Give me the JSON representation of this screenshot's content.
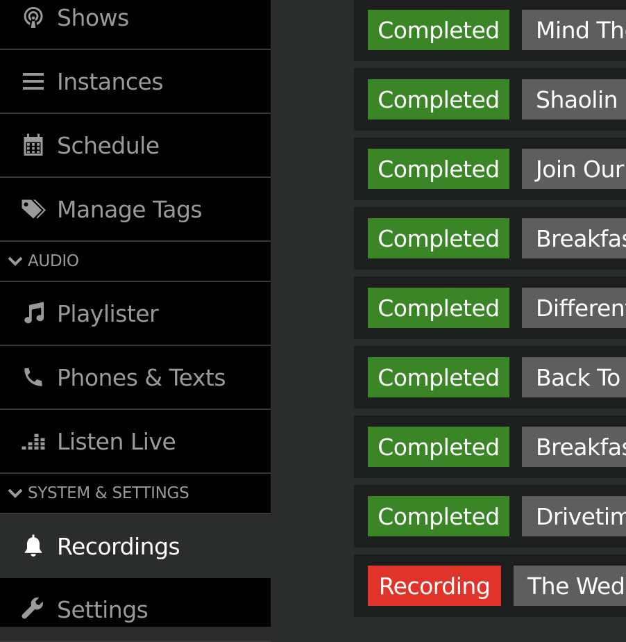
{
  "sidebar": {
    "items": [
      {
        "label": "Shows",
        "icon": "podcast-icon"
      },
      {
        "label": "Instances",
        "icon": "list-icon"
      },
      {
        "label": "Schedule",
        "icon": "calendar-icon"
      },
      {
        "label": "Manage Tags",
        "icon": "tags-icon"
      },
      {
        "label": "Playlister",
        "icon": "music-note-icon"
      },
      {
        "label": "Phones & Texts",
        "icon": "phone-icon"
      },
      {
        "label": "Listen Live",
        "icon": "equalizer-icon"
      },
      {
        "label": "Recordings",
        "icon": "bell-icon",
        "active": true
      },
      {
        "label": "Settings",
        "icon": "wrench-icon"
      }
    ],
    "sections": [
      {
        "label": "AUDIO"
      },
      {
        "label": "SYSTEM & SETTINGS"
      }
    ]
  },
  "recordings": [
    {
      "status": "Completed",
      "title": "Mind The Gap"
    },
    {
      "status": "Completed",
      "title": "Shaolin D"
    },
    {
      "status": "Completed",
      "title": "Join Our C"
    },
    {
      "status": "Completed",
      "title": "Breakfast"
    },
    {
      "status": "Completed",
      "title": "Different"
    },
    {
      "status": "Completed",
      "title": "Back To T"
    },
    {
      "status": "Completed",
      "title": "Breakfast"
    },
    {
      "status": "Completed",
      "title": "Drivetime"
    },
    {
      "status": "Recording",
      "title": "The Wedn"
    }
  ],
  "colors": {
    "completed": "#3a8627",
    "recording": "#e0332a",
    "title_bg": "#5e5e5e",
    "sidebar_bg": "#000000",
    "active_bg": "#2b2c2c"
  }
}
